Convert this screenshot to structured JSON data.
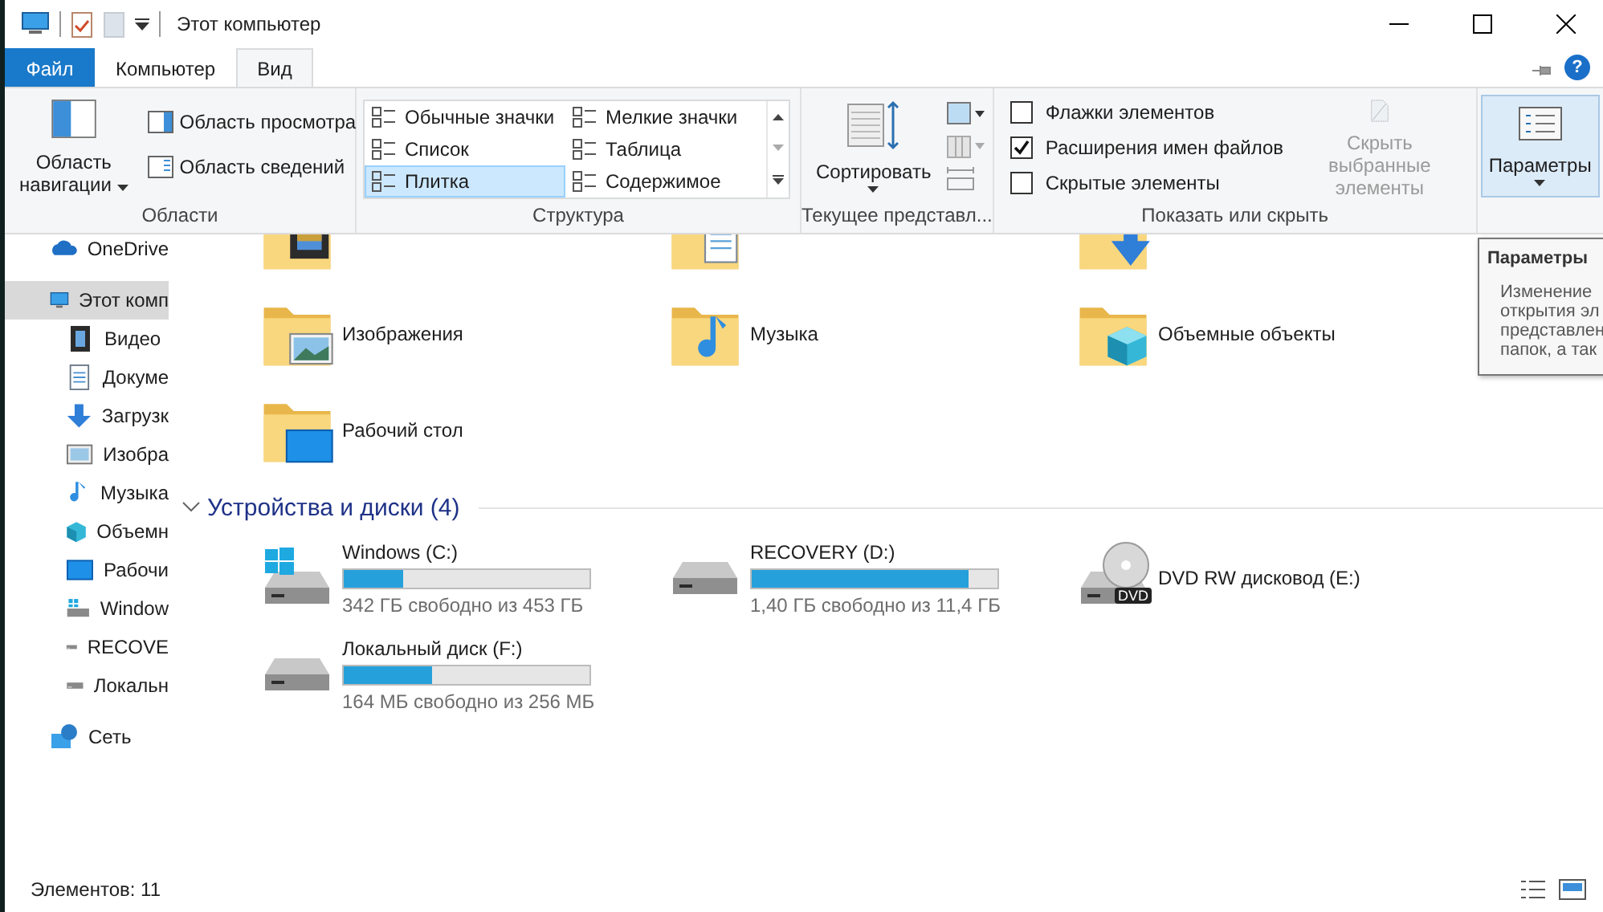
{
  "window": {
    "title": "Этот компьютер"
  },
  "tabs": [
    {
      "label": "Файл",
      "kind": "file",
      "selected": false
    },
    {
      "label": "Компьютер",
      "kind": "tab",
      "selected": false
    },
    {
      "label": "Вид",
      "kind": "tab",
      "selected": true
    }
  ],
  "help_button": "?",
  "ribbon": {
    "panes": {
      "label": "Области",
      "navigation": "Область навигации",
      "preview": "Область просмотра",
      "details": "Область сведений"
    },
    "layout": {
      "label": "Структура",
      "options": [
        {
          "label": "Обычные значки",
          "selected": false
        },
        {
          "label": "Мелкие значки",
          "selected": false
        },
        {
          "label": "Список",
          "selected": false
        },
        {
          "label": "Таблица",
          "selected": false
        },
        {
          "label": "Плитка",
          "selected": true
        },
        {
          "label": "Содержимое",
          "selected": false
        }
      ]
    },
    "current_view": {
      "label": "Текущее представл...",
      "sort": "Сортировать"
    },
    "show_hide": {
      "label": "Показать или скрыть",
      "checkboxes": [
        {
          "label": "Флажки элементов",
          "checked": false
        },
        {
          "label": "Расширения имен файлов",
          "checked": true
        },
        {
          "label": "Скрытые элементы",
          "checked": false
        }
      ],
      "hide_selected": {
        "label": "Скрыть выбранные элементы",
        "disabled": true
      }
    },
    "options": {
      "label": "Параметры"
    }
  },
  "sidebar": {
    "items": [
      {
        "label": "OneDrive",
        "kind": "cloud",
        "selected": false
      },
      {
        "label": "Этот комп",
        "kind": "computer",
        "selected": true,
        "children": [
          {
            "label": "Видео",
            "kind": "video",
            "selected": false
          },
          {
            "label": "Докуме",
            "kind": "documents",
            "selected": false
          },
          {
            "label": "Загрузк",
            "kind": "downloads",
            "selected": false
          },
          {
            "label": "Изобра",
            "kind": "pictures",
            "selected": false
          },
          {
            "label": "Музыка",
            "kind": "music",
            "selected": false
          },
          {
            "label": "Объемн",
            "kind": "objects",
            "selected": false
          },
          {
            "label": "Рабочи",
            "kind": "desktop",
            "selected": false
          },
          {
            "label": "Window",
            "kind": "windows",
            "selected": false
          },
          {
            "label": "RECOVE",
            "kind": "drive",
            "selected": false
          },
          {
            "label": "Локальн",
            "kind": "drive",
            "selected": false
          }
        ]
      },
      {
        "label": "Сеть",
        "kind": "network",
        "selected": false
      }
    ]
  },
  "folders": [
    {
      "kind": "video"
    },
    {
      "kind": "documents"
    },
    {
      "kind": "downloads"
    },
    {
      "label": "Изображения",
      "kind": "pictures"
    },
    {
      "label": "Музыка",
      "kind": "music"
    },
    {
      "label": "Объемные объекты",
      "kind": "objects"
    },
    {
      "label": "Рабочий стол",
      "kind": "desktop"
    }
  ],
  "devices": {
    "title": "Устройства и диски (4)",
    "drives": [
      {
        "name": "Windows (C:)",
        "kind": "windows",
        "level": 0.245,
        "free": "342 ГБ свободно из 453 ГБ"
      },
      {
        "name": "RECOVERY (D:)",
        "kind": "drive",
        "level": 0.88,
        "free": "1,40 ГБ свободно из 11,4 ГБ"
      },
      {
        "name": "DVD RW дисковод (E:)",
        "kind": "dvd",
        "badge": "DVD"
      },
      {
        "name": "Локальный диск (F:)",
        "kind": "drive",
        "level": 0.36,
        "free": "164 МБ свободно из 256 МБ"
      }
    ]
  },
  "tooltip": {
    "title": "Параметры",
    "lines": [
      "Изменение",
      "открытия эл",
      "представлен",
      "папок, а так"
    ]
  },
  "status_bar": {
    "count": "Элементов: 11"
  }
}
